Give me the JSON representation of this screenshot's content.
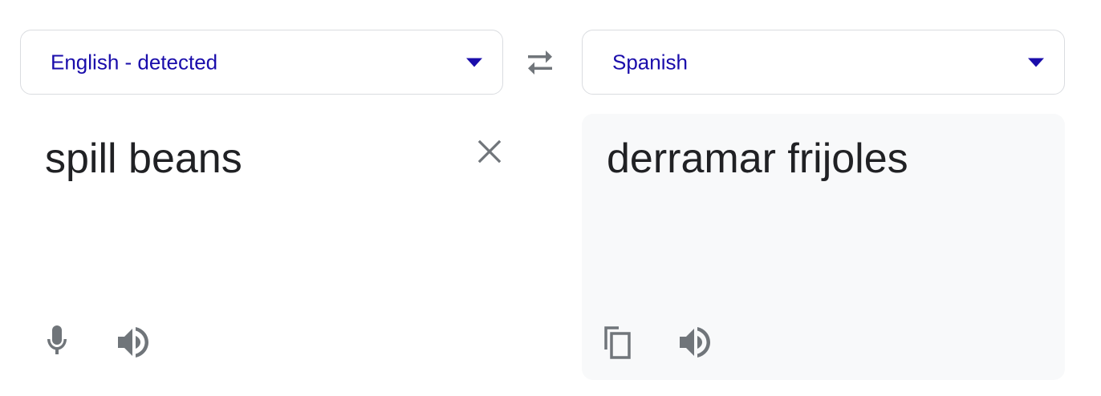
{
  "source": {
    "language_label": "English - detected",
    "text": "spill beans",
    "icons": {
      "clear": "close-icon",
      "mic": "microphone-icon",
      "speaker": "speaker-icon"
    }
  },
  "target": {
    "language_label": "Spanish",
    "text": "derramar frijoles",
    "icons": {
      "copy": "copy-icon",
      "speaker": "speaker-icon"
    }
  },
  "swap_icon": "swap-arrows-icon",
  "colors": {
    "link": "#1a0dab",
    "icon": "#70757a",
    "text": "#202124",
    "border": "#dadce0",
    "target_bg": "#f8f9fa"
  }
}
